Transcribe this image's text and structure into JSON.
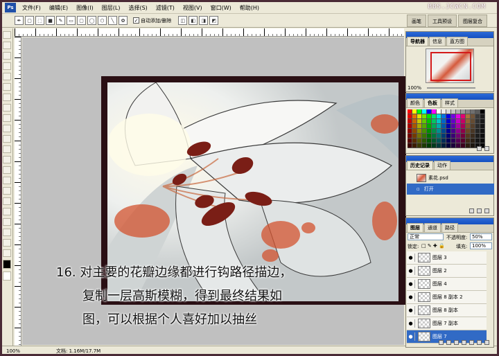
{
  "app": {
    "logo": "Ps",
    "watermark": "BBS.JCWCN.COM"
  },
  "menu": [
    "文件(F)",
    "编辑(E)",
    "图像(I)",
    "图层(L)",
    "选择(S)",
    "滤镜(T)",
    "视图(V)",
    "窗口(W)",
    "帮助(H)"
  ],
  "options_bar": {
    "auto_add_delete_label": "自动添加/删除",
    "auto_add_delete_checked": true
  },
  "palette_well": [
    "画笔",
    "工具预设",
    "图层复合"
  ],
  "caption": [
    "16. 对主要的花瓣边缘都进行钩路径描边，",
    "复制一层高斯模糊，得到最终结果如",
    "图，可以根据个人喜好加以抽丝"
  ],
  "status": {
    "zoom": "100%",
    "doc_size": "文档: 1.16M/17.7M"
  },
  "navigator": {
    "tabs": [
      "导航器",
      "信息",
      "直方图"
    ],
    "zoom": "100%"
  },
  "color_panel": {
    "tabs": [
      "颜色",
      "色板",
      "样式"
    ],
    "swatch_colors": [
      "#ff0000",
      "#ffff00",
      "#00ff00",
      "#00ffff",
      "#0000ff",
      "#ff00ff",
      "#ffffff",
      "#ebebeb",
      "#d6d6d6",
      "#c2c2c2",
      "#adadad",
      "#999999",
      "#858585",
      "#707070",
      "#5c5c5c",
      "#000000"
    ]
  },
  "history": {
    "tabs": [
      "历史记录",
      "动作"
    ],
    "snapshot": "素花.psd",
    "items": [
      "打开"
    ]
  },
  "layers_panel": {
    "tabs": [
      "图层",
      "通道",
      "路径"
    ],
    "blend_mode": "正常",
    "opacity_label": "不透明度:",
    "opacity": "50%",
    "lock_label": "锁定:",
    "fill_label": "填充:",
    "fill": "100%",
    "layers": [
      {
        "name": "图层 3",
        "selected": false
      },
      {
        "name": "图层 2",
        "selected": false
      },
      {
        "name": "图层 4",
        "selected": false
      },
      {
        "name": "图层 8 副本 2",
        "selected": false
      },
      {
        "name": "图层 8 副本",
        "selected": false
      },
      {
        "name": "图层 7 副本",
        "selected": false
      },
      {
        "name": "图层 7",
        "selected": true
      }
    ]
  }
}
